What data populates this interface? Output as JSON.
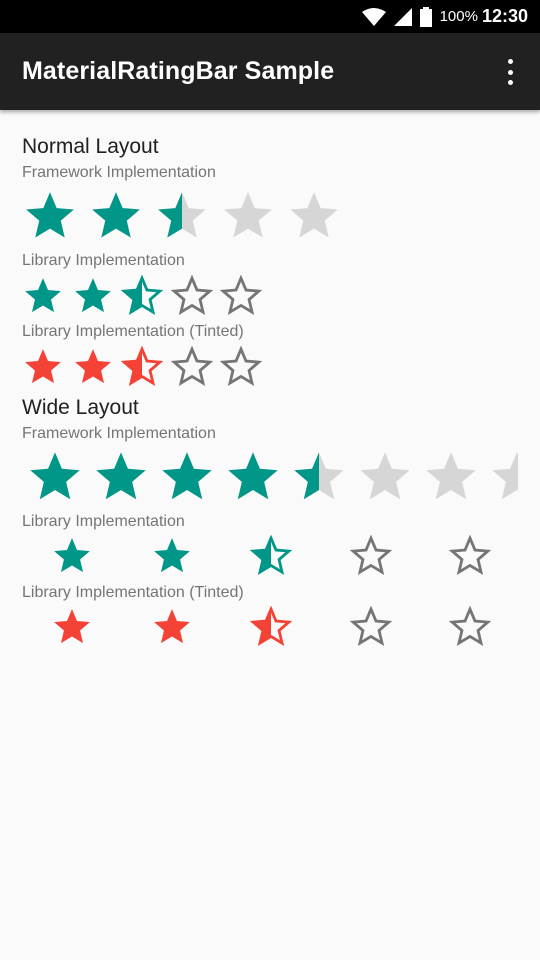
{
  "status_bar": {
    "battery_percent": "100%",
    "time": "12:30",
    "icons": [
      "wifi-icon",
      "cell-signal-icon",
      "battery-icon"
    ]
  },
  "app_bar": {
    "title": "MaterialRatingBar Sample",
    "menu_icon": "overflow-menu-icon"
  },
  "colors": {
    "teal": "#009688",
    "red": "#f44336",
    "framework_empty": "#d6d6d6",
    "outline": "#757575"
  },
  "sections": [
    {
      "title": "Normal Layout",
      "bars": [
        {
          "label": "Framework Implementation",
          "style": "framework",
          "color": "teal",
          "rating": 2.5,
          "num_stars": 5
        },
        {
          "label": "Library Implementation",
          "style": "library",
          "color": "teal",
          "rating": 2.5,
          "num_stars": 5
        },
        {
          "label": "Library Implementation (Tinted)",
          "style": "library",
          "color": "red",
          "rating": 2.5,
          "num_stars": 5
        }
      ]
    },
    {
      "title": "Wide Layout",
      "bars": [
        {
          "label": "Framework Implementation",
          "style": "framework",
          "color": "teal",
          "rating": 4.5,
          "num_stars": 8
        },
        {
          "label": "Library Implementation",
          "style": "library",
          "color": "teal",
          "rating": 2.5,
          "num_stars": 5
        },
        {
          "label": "Library Implementation (Tinted)",
          "style": "library",
          "color": "red",
          "rating": 2.5,
          "num_stars": 5
        }
      ]
    }
  ]
}
